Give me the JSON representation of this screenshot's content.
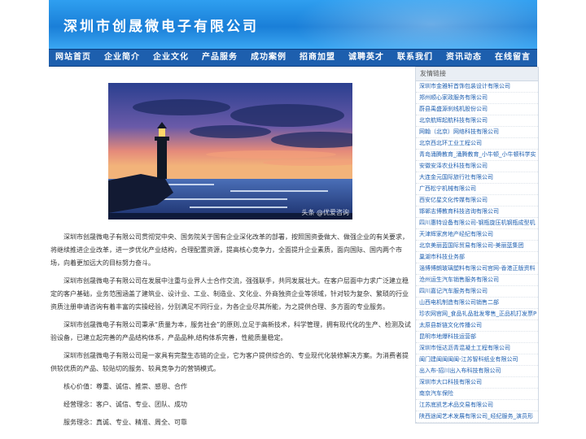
{
  "header": {
    "title": "深圳市创晟微电子有限公司"
  },
  "nav": [
    {
      "label": "网站首页"
    },
    {
      "label": "企业简介"
    },
    {
      "label": "企业文化"
    },
    {
      "label": "产品服务"
    },
    {
      "label": "成功案例"
    },
    {
      "label": "招商加盟"
    },
    {
      "label": "诚聘英才"
    },
    {
      "label": "联系我们"
    },
    {
      "label": "资讯动态"
    },
    {
      "label": "在线留言"
    }
  ],
  "main": {
    "image_watermark": "头条 @优爱咨询",
    "paragraphs": [
      "深圳市创晟微电子有限公司贯彻党中央、国务院关于国有企业深化改革的部署，按照国资委做大、做强企业的有关要求，将继续推进企业改革，进一步优化产业结构，合理配置资源，提高核心竞争力，全面提升企业素质，面向国际、国内两个市场，向着更加远大的目标努力奋斗。",
      "深圳市创晟微电子有限公司在发展中注重与业界人士合作交流，强强联手，共同发展壮大。在客户层面中力求广泛建立稳定的客户基础，业务范围涵盖了建筑业、设计业、工业、制造业、文化业、外商独资企业等领域，针对较为复杂、繁琐的行业资质注册申请咨询有着丰富的实操经验，分别满足不同行业，为各企业尽其所能，为之提供合理、多方面的专业服务。",
      "深圳市创晟微电子有限公司秉承“质量为本，服务社会”的原则,立足于高新技术，科学管理，拥有现代化的生产、检测及试验设备，已建立起完善的产品结构体系，产品品种,结构体系完善，性能质量稳定。",
      "深圳市创晟微电子有限公司是一家具有完整生态链的企业，它为客户提供综合的、专业现代化装修解决方案。为消费者提供较优质的产品、较贴切的服务、较具竞争力的营销模式。",
      "核心价值：尊重、诚信、推崇、感恩、合作",
      "经营理念：客户、诚信、专业、团队、成功",
      "服务理念：真诚、专业、精准、周全、可靠"
    ]
  },
  "sidebar": {
    "heading": "友情链接",
    "links": [
      "深圳市金雅轩首饰包装设计有限公司",
      "郑州顺心家政服务有限公司",
      "蔚县禹盛源刹线机股份公司",
      "北京航辉起航科技有限公司",
      "网翰（北京）网络科技有限公司",
      "北京西北环工业工程公司",
      "青岛涌腾教育_涌腾教育_小牛顿_小牛顿科学实",
      "安徽安泽农业科技有限公司",
      "大连金元国际旅行社有限公司",
      "广西松宁机械有限公司",
      "西安亿星文化传媒有限公司",
      "邯郸志博教育科技咨询有限公司",
      "四川惠特设备有限公司-钢瓶旋压机钢瓶成型机",
      "天津辉家房地产经纪有限公司",
      "北京美丽蓝国际贸易有限公司-美丽蓝集团",
      "巢湖市科技业务部",
      "淄博博朗玻璃塑料有限公司官网-香港正版资料",
      "沧州运生汽车销售服务有限公司",
      "四川嘉记汽车服务有限公司",
      "山西电机制造有限公司销售二部",
      "珍农网官网_食品礼品批发零售_正品机打发票P",
      "太原县新链文化传播公司",
      "昆明市地爆科技运营部",
      "深圳市恒达沥青混凝土工程有限公司",
      "闽门建闽闽闽闽-江苏智科纸业有限公司",
      "出入布-招川出入布科技有限公司",
      "深圳市大口科技有限公司",
      "南京汽车保险",
      "江苏底凯艺术品交易有限公司",
      "陕西途闻艺术发展有限公司_经纪服务_演员形"
    ]
  }
}
